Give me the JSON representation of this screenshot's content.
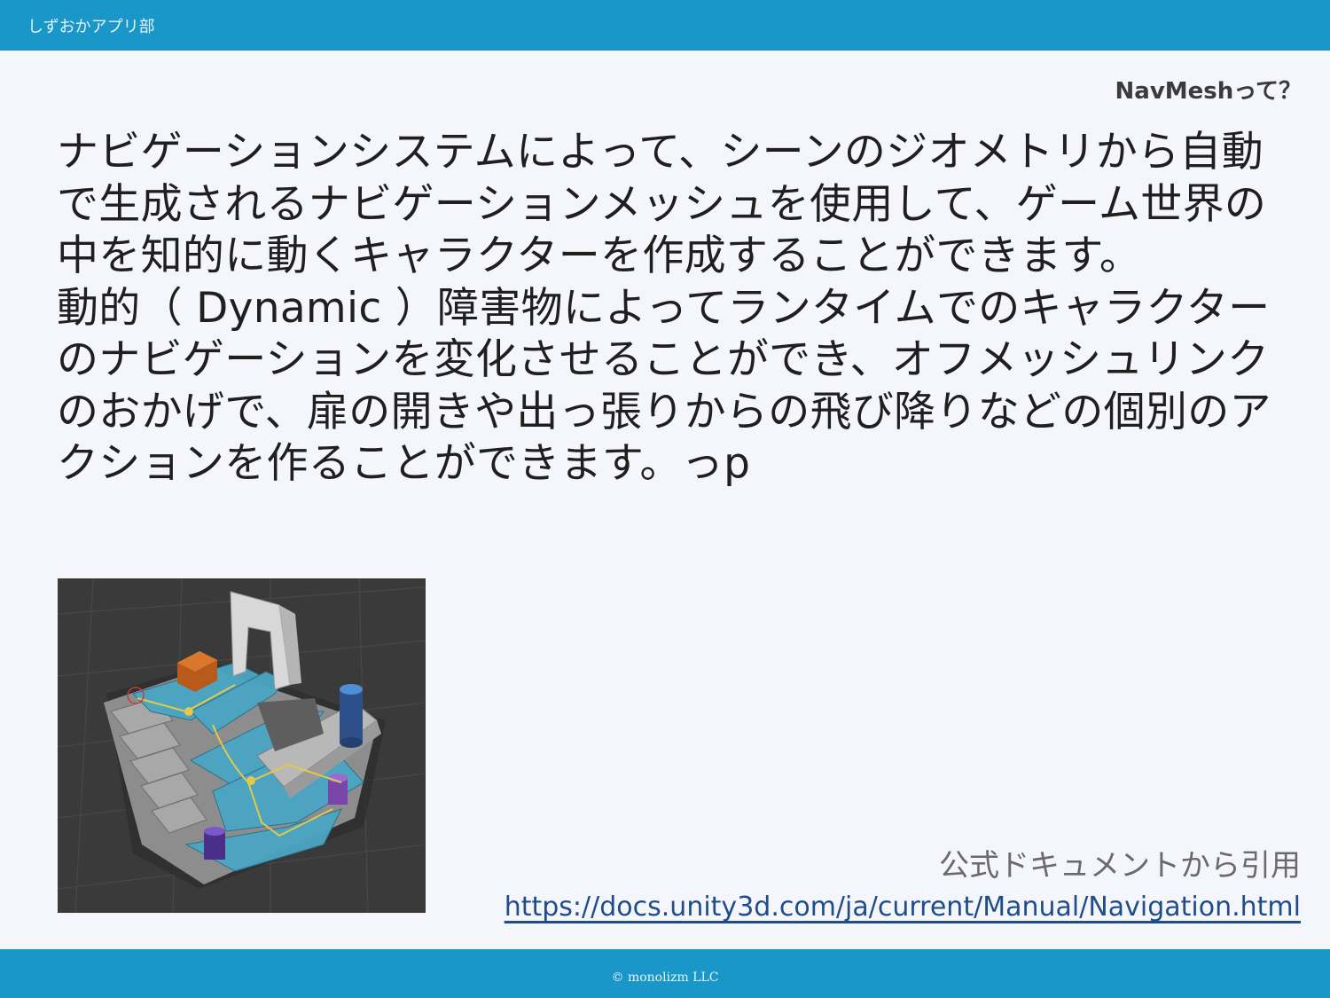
{
  "header": {
    "org_name": "しずおかアプリ部"
  },
  "slide": {
    "title": "NavMeshって？",
    "paragraphs": [
      "ナビゲーションシステムによって、シーンのジオメトリから自動で生成されるナビゲーションメッシュを使用して、ゲーム世界の中を知的に動くキャラクターを作成することができます。",
      "動的（ Dynamic ）障害物によってランタイムでのキャラクターのナビゲーションを変化させることができ、オフメッシュリンクのおかげで、扉の開きや出っ張りからの飛び降りなどの個別のアクションを作ることができます。っp"
    ],
    "citation": "公式ドキュメントから引用",
    "source_url": "https://docs.unity3d.com/ja/current/Manual/Navigation.html"
  },
  "footer": {
    "copyright": "© monolizm LLC"
  },
  "colors": {
    "bar": "#1897c8",
    "background": "#f5f6fb",
    "link": "#1f4d8c",
    "navmesh": "#4aa6c4"
  }
}
